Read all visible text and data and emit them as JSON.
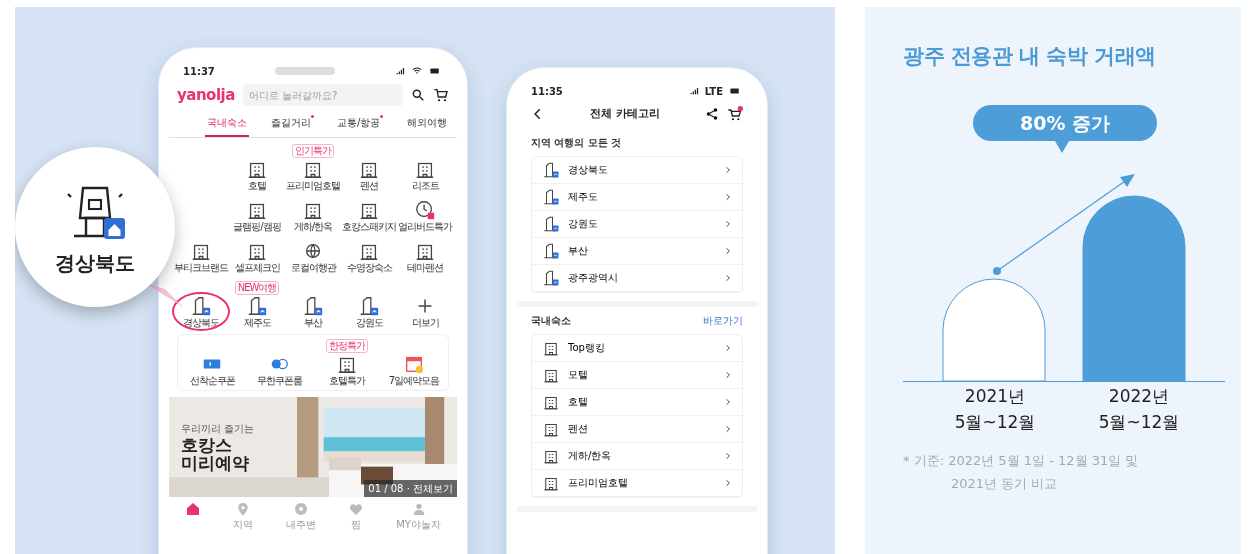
{
  "magnifier": {
    "label": "경상북도"
  },
  "left_phone": {
    "status_time": "11:37",
    "logo": "yanolja",
    "search": {
      "placeholder": "어디로 놀러갈까요?"
    },
    "tabs": [
      {
        "label": "국내숙소",
        "selected": true,
        "dot": false
      },
      {
        "label": "즐길거리",
        "selected": false,
        "dot": true
      },
      {
        "label": "교통/항공",
        "selected": false,
        "dot": true
      },
      {
        "label": "해외여행",
        "selected": false,
        "dot": false
      }
    ],
    "category_rows": [
      {
        "kind": "icons",
        "items": [
          {
            "kind": "building",
            "label": "호텔"
          },
          {
            "kind": "building",
            "label": "프리미엄호텔",
            "tag": "인기특가"
          },
          {
            "kind": "building",
            "label": "펜션"
          },
          {
            "kind": "building",
            "label": "리조트"
          }
        ]
      },
      {
        "kind": "icons",
        "items": [
          {
            "kind": "building",
            "label": "글램핑/캠핑"
          },
          {
            "kind": "building",
            "label": "게하/한옥"
          },
          {
            "kind": "building",
            "label": "호캉스패키지"
          },
          {
            "kind": "clock",
            "label": "얼리버드특가"
          }
        ]
      },
      {
        "kind": "icons",
        "items": [
          {
            "kind": "building",
            "label": "부티크브랜드"
          },
          {
            "kind": "building",
            "label": "셀프체크인"
          },
          {
            "kind": "globe",
            "label": "로컬여행관"
          },
          {
            "kind": "building",
            "label": "수영장숙소"
          },
          {
            "kind": "building",
            "label": "테마펜션"
          }
        ]
      },
      {
        "kind": "icons",
        "items": [
          {
            "kind": "region",
            "label": "경상북도",
            "highlighted": true
          },
          {
            "kind": "region",
            "label": "제주도",
            "tag": "NEW여행"
          },
          {
            "kind": "region",
            "label": "부산"
          },
          {
            "kind": "region",
            "label": "강원도"
          },
          {
            "kind": "more",
            "label": "더보기"
          }
        ]
      },
      {
        "kind": "boxes",
        "items": [
          {
            "kind": "ticket",
            "label": "선착순쿠폰"
          },
          {
            "kind": "coupon",
            "label": "무한쿠폰룸"
          },
          {
            "kind": "building",
            "label": "호텔특가",
            "tag": "한정특가"
          },
          {
            "kind": "calendar",
            "label": "7일예약모음"
          }
        ]
      }
    ],
    "banner": {
      "kind": "picture",
      "subtitle": "우리끼리 즐기는",
      "title_lines": [
        "호캉스",
        "미리예약"
      ],
      "counter": "01 / 08 · 전체보기"
    },
    "bottom_nav": [
      {
        "kind": "home",
        "selected": true
      },
      {
        "kind": "pin",
        "label": "지역",
        "selected": false
      },
      {
        "kind": "nearby",
        "label": "내주변",
        "selected": false
      },
      {
        "kind": "heart",
        "label": "찜",
        "selected": false
      },
      {
        "kind": "person",
        "label": "MY야놀자",
        "selected": false
      }
    ]
  },
  "right_phone": {
    "status_time": "11:35",
    "network": "LTE",
    "title": "전체 카테고리",
    "sections": [
      {
        "title": "지역 여행의 모든 것",
        "items": [
          {
            "kind": "region",
            "label": "경상북도"
          },
          {
            "kind": "region",
            "label": "제주도"
          },
          {
            "kind": "region",
            "label": "강원도"
          },
          {
            "kind": "region",
            "label": "부산"
          },
          {
            "kind": "region",
            "label": "광주광역시"
          }
        ]
      },
      {
        "title": "국내숙소",
        "link": "바로가기",
        "items": [
          {
            "kind": "building",
            "label": "Top랭킹"
          },
          {
            "kind": "building",
            "label": "모텔"
          },
          {
            "kind": "building",
            "label": "호텔"
          },
          {
            "kind": "building",
            "label": "펜션"
          },
          {
            "kind": "building",
            "label": "게하/한옥"
          },
          {
            "kind": "building",
            "label": "프리미엄호텔"
          }
        ]
      }
    ]
  },
  "stats": {
    "title": "광주 전용관 내 숙박 거래액",
    "callout": "80% 증가",
    "bars": [
      {
        "year": "2021년",
        "period": "5월~12월",
        "filled": false
      },
      {
        "year": "2022년",
        "period": "5월~12월",
        "filled": true
      }
    ],
    "footnote": "* 기준: 2022년 5월 1일 - 12월 31일 및 2021년 동기 비교"
  }
}
